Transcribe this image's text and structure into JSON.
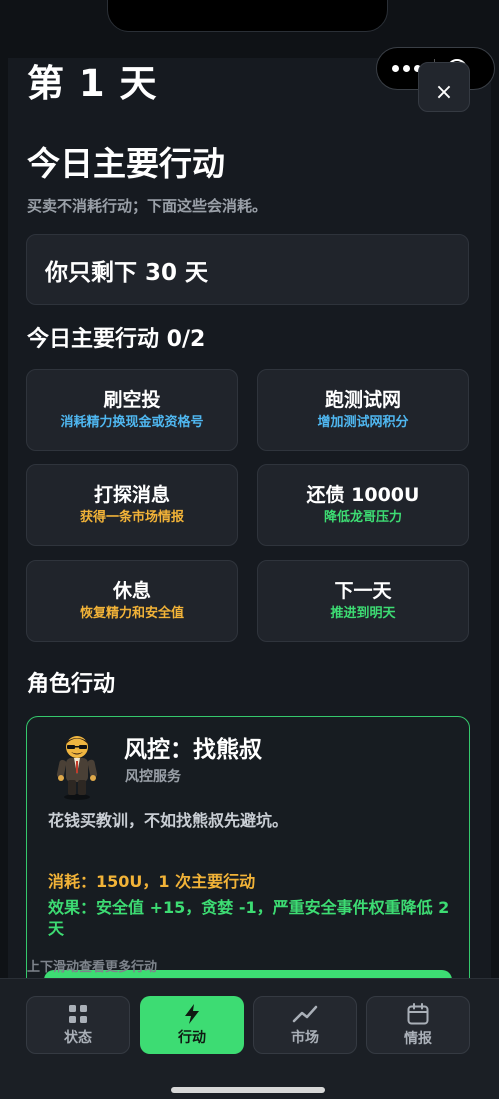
{
  "header": {
    "day_title": "第 1 天",
    "close_label": "×"
  },
  "main": {
    "section_title": "今日主要行动",
    "subtitle": "买卖不消耗行动；下面这些会消耗。",
    "remaining": "你只剩下 30 天",
    "counter": "今日主要行动 0/2",
    "actions": [
      {
        "title": "刷空投",
        "sub": "消耗精力换现金或资格号",
        "color": "#4fb7f0"
      },
      {
        "title": "跑测试网",
        "sub": "增加测试网积分",
        "color": "#4fb7f0"
      },
      {
        "title": "打探消息",
        "sub": "获得一条市场情报",
        "color": "#f2b338"
      },
      {
        "title": "还债 1000U",
        "sub": "降低龙哥压力",
        "color": "#3ddc73"
      },
      {
        "title": "休息",
        "sub": "恢复精力和安全值",
        "color": "#f2b338"
      },
      {
        "title": "下一天",
        "sub": "推进到明天",
        "color": "#3ddc73"
      }
    ]
  },
  "role": {
    "section_title": "角色行动",
    "card": {
      "name": "风控：找熊叔",
      "subtitle": "风控服务",
      "description": "花钱买教训，不如找熊叔先避坑。",
      "cost": "消耗：150U，1 次主要行动",
      "effect": "效果：安全值 +15，贪婪 -1，严重安全事件权重降低 2 天"
    },
    "scroll_hint": "上下滑动查看更多行动"
  },
  "tabs": [
    {
      "label": "状态",
      "icon": "grid-icon",
      "active": false
    },
    {
      "label": "行动",
      "icon": "bolt-icon",
      "active": true
    },
    {
      "label": "市场",
      "icon": "trend-icon",
      "active": false
    },
    {
      "label": "情报",
      "icon": "calendar-icon",
      "active": false
    }
  ],
  "colors": {
    "accent_green": "#3ddc73",
    "info_blue": "#4fb7f0",
    "warn_yellow": "#f2b338",
    "background": "#161a20"
  }
}
